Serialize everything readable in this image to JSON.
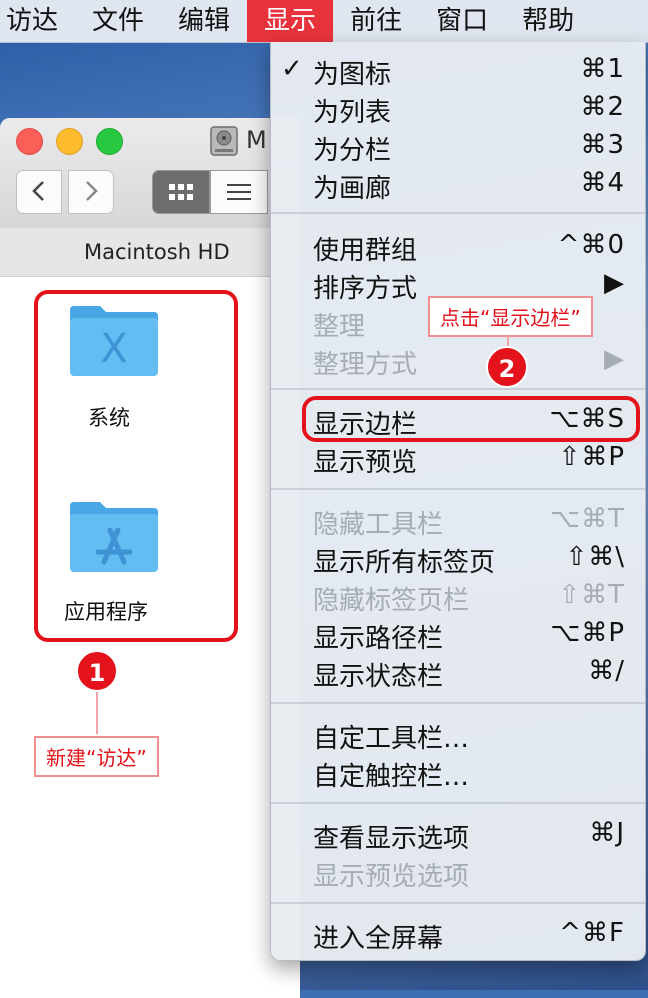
{
  "menubar": {
    "items": [
      "访达",
      "文件",
      "编辑",
      "显示",
      "前往",
      "窗口",
      "帮助"
    ],
    "active_index": 3
  },
  "finder": {
    "title": "M",
    "path": "Macintosh HD",
    "folders": [
      {
        "label": "系统",
        "icon": "system-folder-icon"
      },
      {
        "label": "应用程序",
        "icon": "applications-folder-icon"
      }
    ]
  },
  "menu": {
    "groups": [
      [
        {
          "label": "为图标",
          "shortcut": "⌘1",
          "checked": true,
          "enabled": true
        },
        {
          "label": "为列表",
          "shortcut": "⌘2",
          "enabled": true
        },
        {
          "label": "为分栏",
          "shortcut": "⌘3",
          "enabled": true
        },
        {
          "label": "为画廊",
          "shortcut": "⌘4",
          "enabled": true
        }
      ],
      [
        {
          "label": "使用群组",
          "shortcut": "^⌘0",
          "enabled": true
        },
        {
          "label": "排序方式",
          "shortcut": "▶",
          "enabled": true
        },
        {
          "label": "整理",
          "shortcut": "",
          "enabled": false
        },
        {
          "label": "整理方式",
          "shortcut": "▶",
          "enabled": false
        }
      ],
      [
        {
          "label": "显示边栏",
          "shortcut": "⌥⌘S",
          "enabled": true
        },
        {
          "label": "显示预览",
          "shortcut": "⇧⌘P",
          "enabled": true
        }
      ],
      [
        {
          "label": "隐藏工具栏",
          "shortcut": "⌥⌘T",
          "enabled": false
        },
        {
          "label": "显示所有标签页",
          "shortcut": "⇧⌘\\",
          "enabled": true
        },
        {
          "label": "隐藏标签页栏",
          "shortcut": "⇧⌘T",
          "enabled": false
        },
        {
          "label": "显示路径栏",
          "shortcut": "⌥⌘P",
          "enabled": true
        },
        {
          "label": "显示状态栏",
          "shortcut": "⌘/",
          "enabled": true
        }
      ],
      [
        {
          "label": "自定工具栏…",
          "shortcut": "",
          "enabled": true
        },
        {
          "label": "自定触控栏…",
          "shortcut": "",
          "enabled": true
        }
      ],
      [
        {
          "label": "查看显示选项",
          "shortcut": "⌘J",
          "enabled": true
        },
        {
          "label": "显示预览选项",
          "shortcut": "",
          "enabled": false
        }
      ],
      [
        {
          "label": "进入全屏幕",
          "shortcut": "^⌘F",
          "enabled": true
        }
      ]
    ]
  },
  "annotations": {
    "step1": {
      "number": "1",
      "text": "新建“访达”"
    },
    "step2": {
      "number": "2",
      "text": "点击“显示边栏”"
    }
  },
  "colors": {
    "accent_red": "#e3121b",
    "folder_blue": "#5fb7ef"
  }
}
